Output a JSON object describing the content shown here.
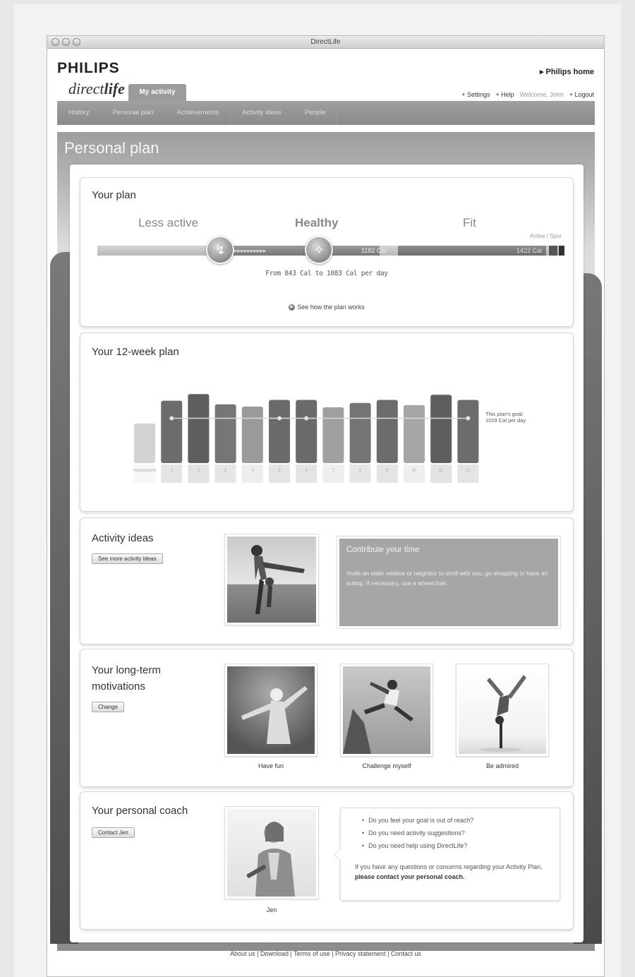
{
  "window": {
    "title": "DirectLife"
  },
  "brand": {
    "logo": "PHILIPS",
    "product_prefix": "direct",
    "product_suffix": "life"
  },
  "header": {
    "active_tab": "My activity",
    "philips_home": "▸ Philips home",
    "settings": "+ Settings",
    "help": "+ Help",
    "welcome": "Welcome, John",
    "logout": "+ Logout"
  },
  "nav": [
    "History",
    "Personal plan",
    "Achievements",
    "Activity ideas",
    "People"
  ],
  "page_title": "Personal plan",
  "your_plan": {
    "title": "Your plan",
    "levels": [
      "Less active",
      "Healthy",
      "Fit"
    ],
    "active_sport": "Active | Spor",
    "healthy_max": "1182 Cal",
    "fit_max": "1422 Cal",
    "range": "From 843 Cal to 1083 Cal per day",
    "how_link": "See how the plan works"
  },
  "twelve_week": {
    "title": "Your 12-week plan",
    "goal_line1": "This plan's goal:",
    "goal_line2": "1029 Cal per day"
  },
  "chart_data": {
    "type": "bar",
    "categories": [
      "Assessment",
      "1",
      "2",
      "3",
      "4",
      "5",
      "6",
      "7",
      "8",
      "9",
      "10",
      "11",
      "12"
    ],
    "values": [
      54,
      85,
      94,
      80,
      77,
      86,
      86,
      76,
      82,
      86,
      79,
      93,
      86
    ],
    "goal_line": 61,
    "ylim": [
      0,
      100
    ]
  },
  "activity_ideas": {
    "title": "Activity ideas",
    "button": "See more activity ideas",
    "idea_title": "Contribute your time",
    "idea_text": "Invite an older relative or neighbor to stroll with you, go shopping or have an outing. If necessary, use a wheelchair."
  },
  "motivations": {
    "title_line1": "Your long-term",
    "title_line2": "motivations",
    "button": "Change",
    "items": [
      "Have fun",
      "Challenge myself",
      "Be admired"
    ]
  },
  "coach": {
    "title": "Your personal coach",
    "button": "Contact Jen",
    "name": "Jen",
    "questions": [
      "Do you feel your goal is out of reach?",
      "Do you need activity suggestions?",
      "Do you need help using DirectLife?"
    ],
    "message_plain": "If you have any questions or concerns regarding your Activity Plan, ",
    "message_bold": "please contact your personal coach."
  },
  "footer": {
    "about": "About us",
    "download": "Download",
    "terms": "Terms of use",
    "privacy": "Privacy statement",
    "contact": "Contact us"
  }
}
